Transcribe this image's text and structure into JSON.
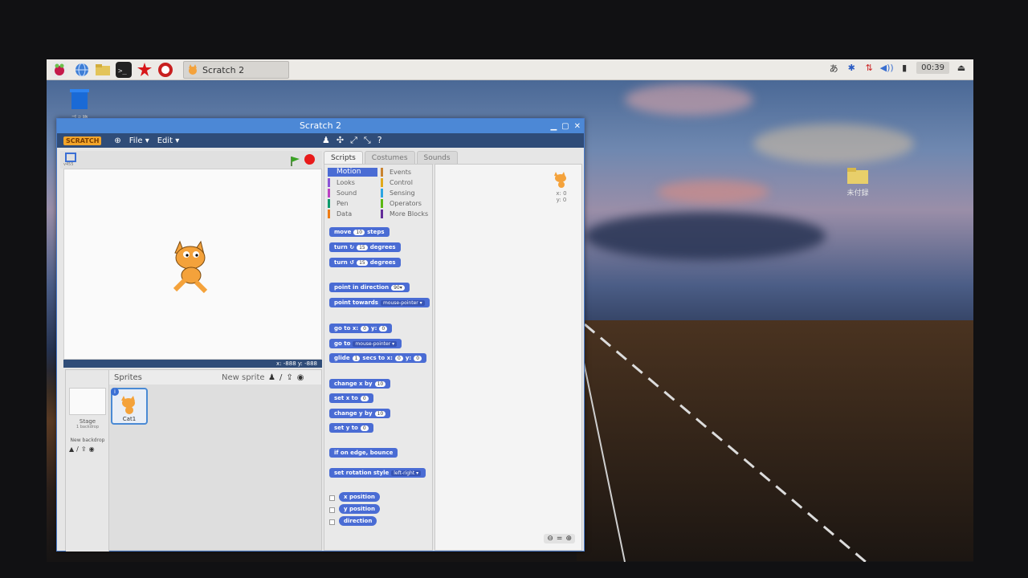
{
  "taskbar": {
    "task_label": "Scratch 2",
    "ime": "あ",
    "clock": "00:39"
  },
  "desktop": {
    "trash_label": "ゴミ箱",
    "folder_label": "未付録"
  },
  "window": {
    "title": "Scratch 2",
    "menu": {
      "logo": "SCRATCH",
      "file": "File ▾",
      "edit": "Edit ▾"
    }
  },
  "stage": {
    "version": "v455",
    "coords": "x: -888  y: -888"
  },
  "sprites_panel": {
    "header": "Sprites",
    "new_sprite": "New sprite",
    "stage_label": "Stage",
    "stage_sub": "1 backdrop",
    "new_backdrop": "New backdrop",
    "sprite_name": "Cat1"
  },
  "tabs": [
    "Scripts",
    "Costumes",
    "Sounds"
  ],
  "categories": {
    "left": [
      "Motion",
      "Looks",
      "Sound",
      "Pen",
      "Data"
    ],
    "right": [
      "Events",
      "Control",
      "Sensing",
      "Operators",
      "More Blocks"
    ],
    "colors": [
      "#4a6cd4",
      "#8a55d7",
      "#bb42c3",
      "#0e9a6c",
      "#ee7d16",
      "#c88330",
      "#e1a91a",
      "#2ca5e2",
      "#5cb712",
      "#632d99"
    ]
  },
  "blocks": {
    "move": {
      "label": "move",
      "arg": "10",
      "suffix": "steps"
    },
    "turn_right": {
      "label": "turn ↻",
      "arg": "15",
      "suffix": "degrees"
    },
    "turn_left": {
      "label": "turn ↺",
      "arg": "15",
      "suffix": "degrees"
    },
    "point_dir": {
      "label": "point in direction",
      "arg": "90▾"
    },
    "point_towards": {
      "label": "point towards",
      "dd": "mouse-pointer ▾"
    },
    "goto_xy": {
      "label": "go to x:",
      "x": "0",
      "ylabel": "y:",
      "y": "0"
    },
    "goto": {
      "label": "go to",
      "dd": "mouse-pointer ▾"
    },
    "glide": {
      "label": "glide",
      "secs": "1",
      "mid": "secs to x:",
      "x": "0",
      "ylabel": "y:",
      "y": "0"
    },
    "change_x": {
      "label": "change x by",
      "arg": "10"
    },
    "set_x": {
      "label": "set x to",
      "arg": "0"
    },
    "change_y": {
      "label": "change y by",
      "arg": "10"
    },
    "set_y": {
      "label": "set y to",
      "arg": "0"
    },
    "bounce": {
      "label": "if on edge, bounce"
    },
    "rotation": {
      "label": "set rotation style",
      "dd": "left-right ▾"
    },
    "x_pos": {
      "label": "x position"
    },
    "y_pos": {
      "label": "y position"
    },
    "direction": {
      "label": "direction"
    }
  },
  "sprite_info": {
    "x": "x: 0",
    "y": "y: 0"
  }
}
